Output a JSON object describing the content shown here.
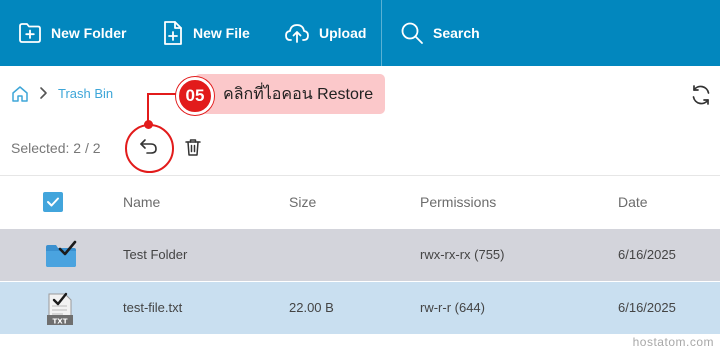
{
  "toolbar": {
    "new_folder": "New Folder",
    "new_file": "New File",
    "upload": "Upload",
    "search": "Search"
  },
  "breadcrumb": {
    "current": "Trash Bin"
  },
  "selection": {
    "text": "Selected: 2 / 2"
  },
  "annotation": {
    "step": "05",
    "text": "คลิกที่ไอคอน Restore"
  },
  "table": {
    "headers": {
      "name": "Name",
      "size": "Size",
      "permissions": "Permissions",
      "date": "Date"
    },
    "rows": [
      {
        "name": "Test Folder",
        "size": "",
        "permissions": "rwx-rx-rx (755)",
        "date": "6/16/2025",
        "icon": "folder-check-icon"
      },
      {
        "name": "test-file.txt",
        "size": "22.00 B",
        "permissions": "rw-r-r (644)",
        "date": "6/16/2025",
        "icon": "txt-file-check-icon"
      }
    ]
  },
  "watermark": "hostatom.com",
  "colors": {
    "toolbar": "#0287be",
    "accent": "#42a5dc",
    "row_selected_1": "#d3d4db",
    "row_selected_2": "#c9dff0",
    "annotation_red": "#e21b1b",
    "callout_bg": "#fbc8ca"
  }
}
